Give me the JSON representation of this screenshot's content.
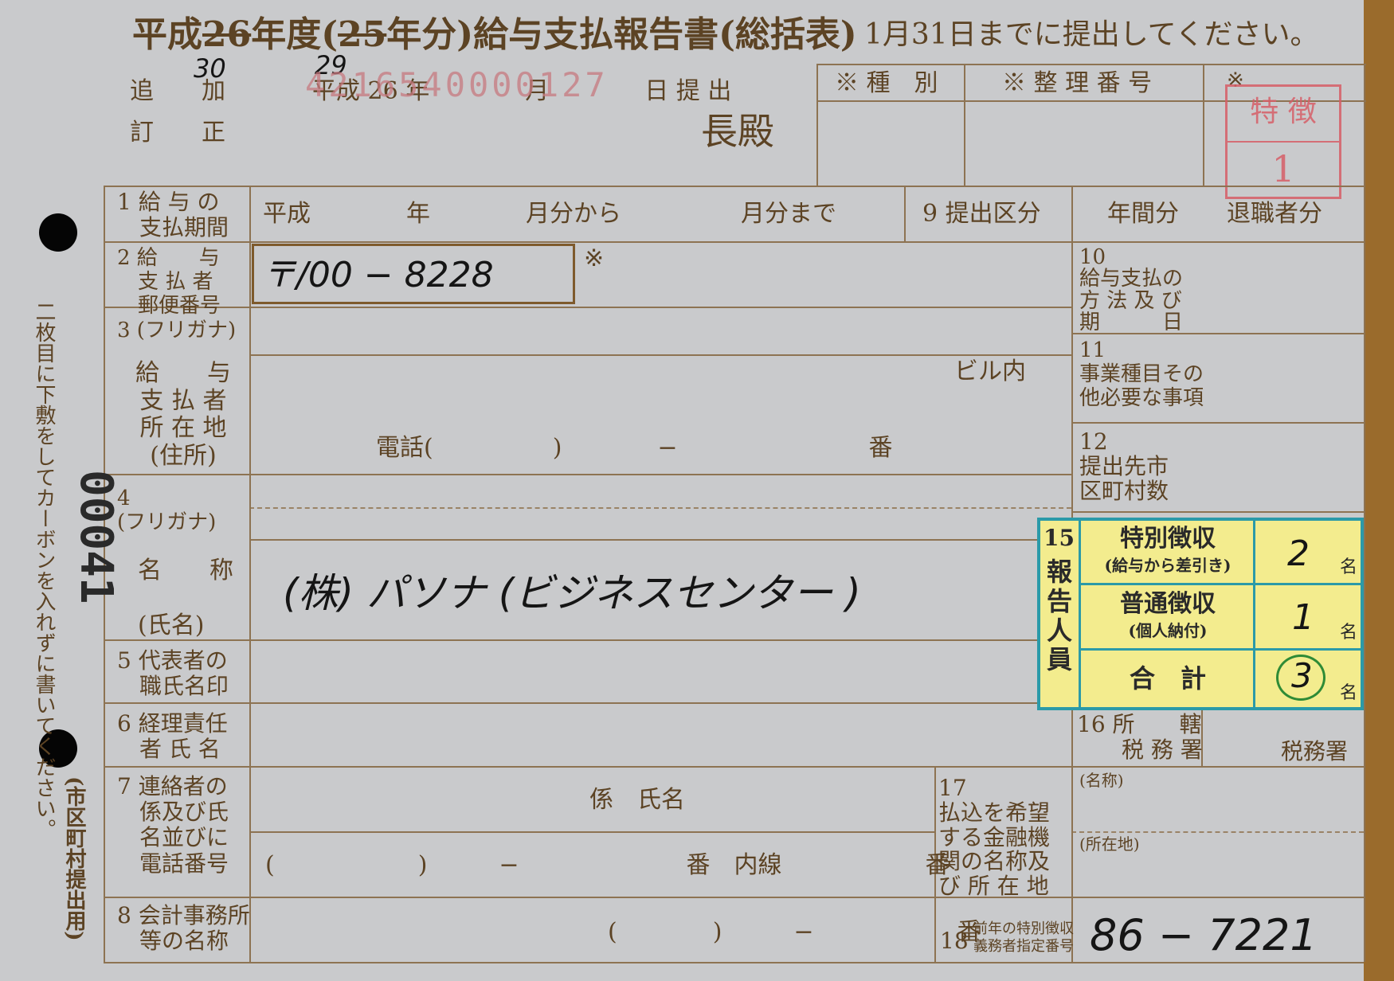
{
  "header": {
    "title_part1": "平成",
    "year_struck": "26",
    "title_part2": "年度(",
    "year2_struck": "25",
    "title_part3": "年分)給与支払報告書(総括表)",
    "deadline": "1月31日までに提出してください。",
    "year_fix": "30",
    "year2_fix": "29",
    "add_label": "追　　加",
    "correct_label": "訂　　正",
    "date_line": "平成 26 年　　　　月　　　　日 提 出",
    "stamp_number": "4216540000127",
    "addressee": "長殿"
  },
  "office_box": {
    "kind_label": "※ 種　別",
    "ref_label": "※ 整 理 番 号",
    "asterisk": "※",
    "stamp_top": "特 徴",
    "stamp_bottom": "1"
  },
  "rows": {
    "r1_label": "1 給 与 の\n　支払期間",
    "r1_value": "平成　　　　年　　　　月分から　　　　　月分まで",
    "r9_label": "9 提出区分",
    "r9_opt1": "年間分",
    "r9_opt2": "退職者分",
    "r2_label": "2 給　　与\n　支 払 者\n　郵便番号",
    "r2_postal": "〒/00 − 8228",
    "r2_mark": "※",
    "r3_label": "3 (フリガナ)",
    "r3_label2": "給　　与\n支 払 者\n所 在 地\n(住所)",
    "r3_building": "ビル内",
    "r3_phone": "電話(　　　　　)　　　　−　　　　　　　　番",
    "r4_label": "4\n(フリガナ)",
    "r4_label2": "名　　称\n\n(氏名)",
    "r4_name": "(株) パソナ (ビジネスセンター )",
    "r5_label": "5 代表者の\n　職氏名印",
    "r6_label": "6 経理責任\n　者 氏 名",
    "r7_label": "7 連絡者の\n　係及び氏\n　名並びに\n　電話番号",
    "r7_contact": "係　氏名",
    "r7_phone": "(　　　　　　)　　　−　　　　　　　番　内線　　　　　　番",
    "r8_label": "8 会計事務所\n　等の名称",
    "r8_phone": "(　　　　)　　　−　　　　　　番"
  },
  "right": {
    "r10_label": "10\n給与支払の\n方 法 及 び\n期　　　日",
    "r11_label": "11\n事業種目その\n他必要な事項",
    "r12_label": "12\n提出先市\n区町村数",
    "r16_label": "16 所　　轄\n　　税 務 署",
    "r16_suffix": "税務署",
    "r17_label": "17\n払込を希望\nする金融機\n関の名称及\nび 所 在 地",
    "r17_name": "(名称)",
    "r17_address": "(所在地)",
    "r18_num": "18",
    "r18_label": "前年の特別徴収\n義務者指定番号",
    "r18_value": "86 − 7221"
  },
  "report_box": {
    "num": "15",
    "title": "報\n告\n人\n員",
    "special_label": "特別徴収",
    "special_sub": "(給与から差引き)",
    "special_count": "2",
    "normal_label": "普通徴収",
    "normal_sub": "(個人納付)",
    "normal_count": "1",
    "total_label": "合　計",
    "total_count": "3",
    "unit": "名",
    "color_fill": "#f3ec8e",
    "color_border": "#2b9aa8"
  },
  "margin": {
    "instruction": "二枚目に下敷をしてカーボンを入れずに書いてください。",
    "serial": "00041",
    "footer": "(市区町村提出用)"
  }
}
